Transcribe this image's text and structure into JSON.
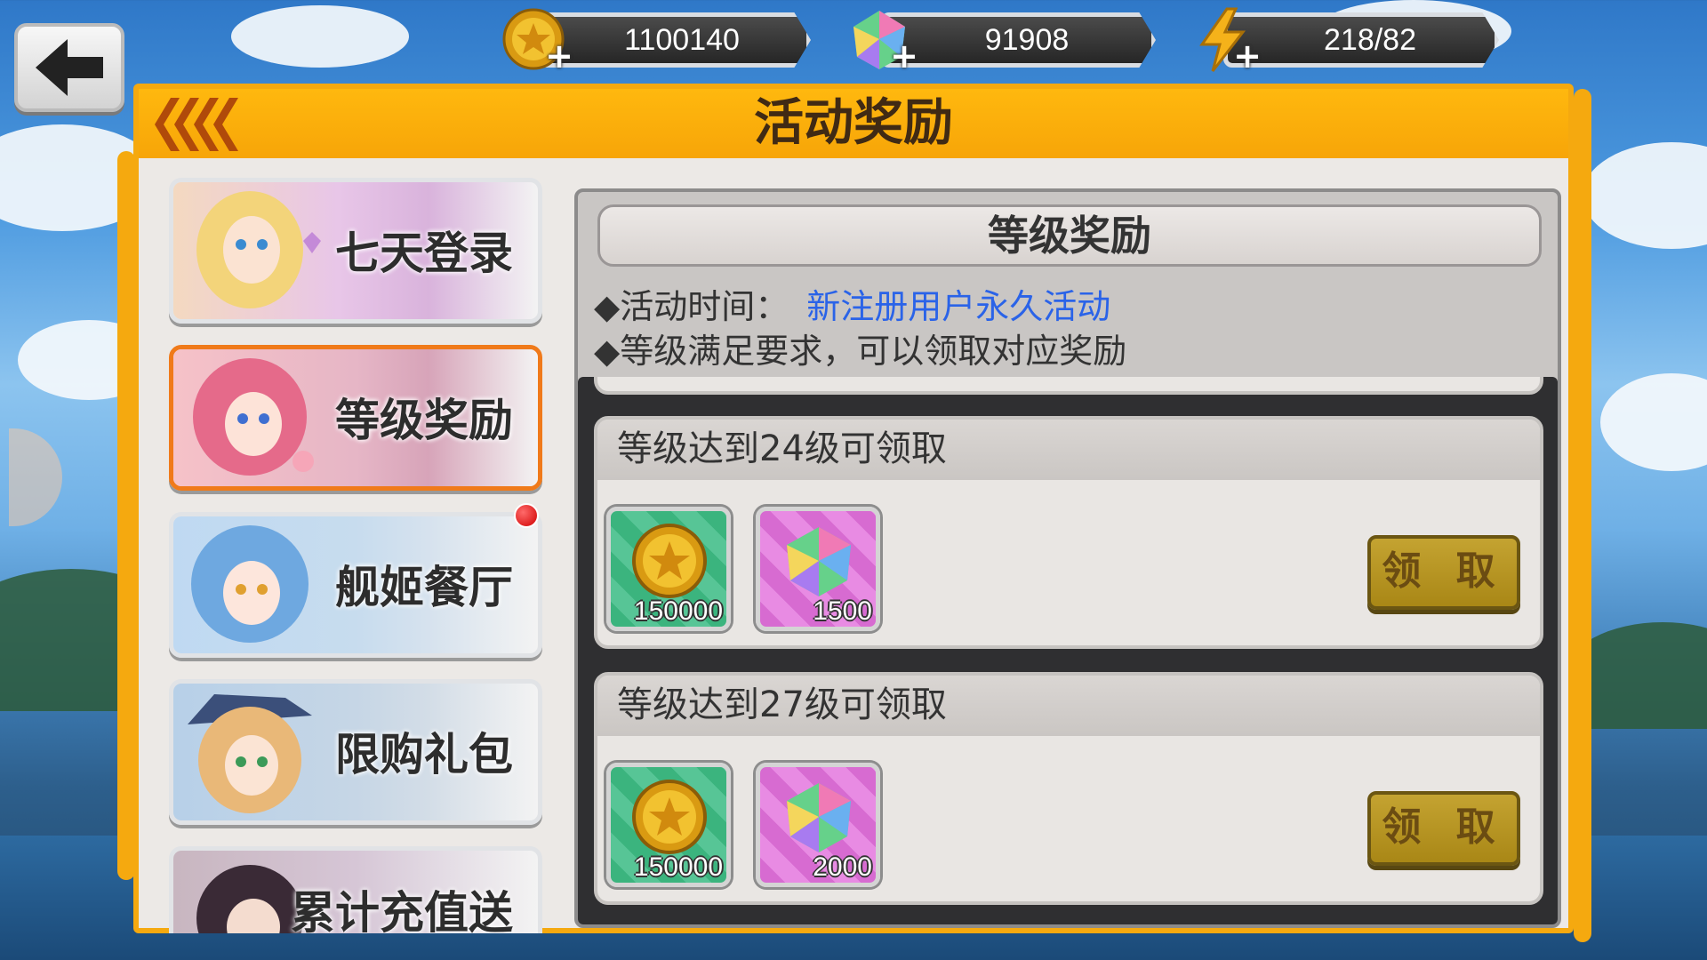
{
  "resources": {
    "gold": "1100140",
    "gems": "91908",
    "energy": "218/82"
  },
  "panel": {
    "title": "活动奖励"
  },
  "tabs": [
    {
      "label": "七天登录",
      "active": false
    },
    {
      "label": "等级奖励",
      "active": true
    },
    {
      "label": "舰姬餐厅",
      "active": false,
      "badge": true
    },
    {
      "label": "限购礼包",
      "active": false
    },
    {
      "label": "累计充值送",
      "active": false
    }
  ],
  "content": {
    "title": "等级奖励",
    "time_label": "◆活动时间：",
    "time_value": "新注册用户永久活动",
    "note": "◆等级满足要求，可以领取对应奖励",
    "rewards": [
      {
        "heading": "等级达到24级可领取",
        "items": [
          {
            "type": "gold-coin-icon",
            "amount": "150000"
          },
          {
            "type": "rainbow-gem-icon",
            "amount": "1500"
          }
        ],
        "button": "领 取"
      },
      {
        "heading": "等级达到27级可领取",
        "items": [
          {
            "type": "gold-coin-icon",
            "amount": "150000"
          },
          {
            "type": "rainbow-gem-icon",
            "amount": "2000"
          }
        ],
        "button": "领 取"
      }
    ]
  },
  "colors": {
    "accent": "#f5a90f",
    "link": "#2a63e8",
    "claim_button": "#b8952a"
  }
}
